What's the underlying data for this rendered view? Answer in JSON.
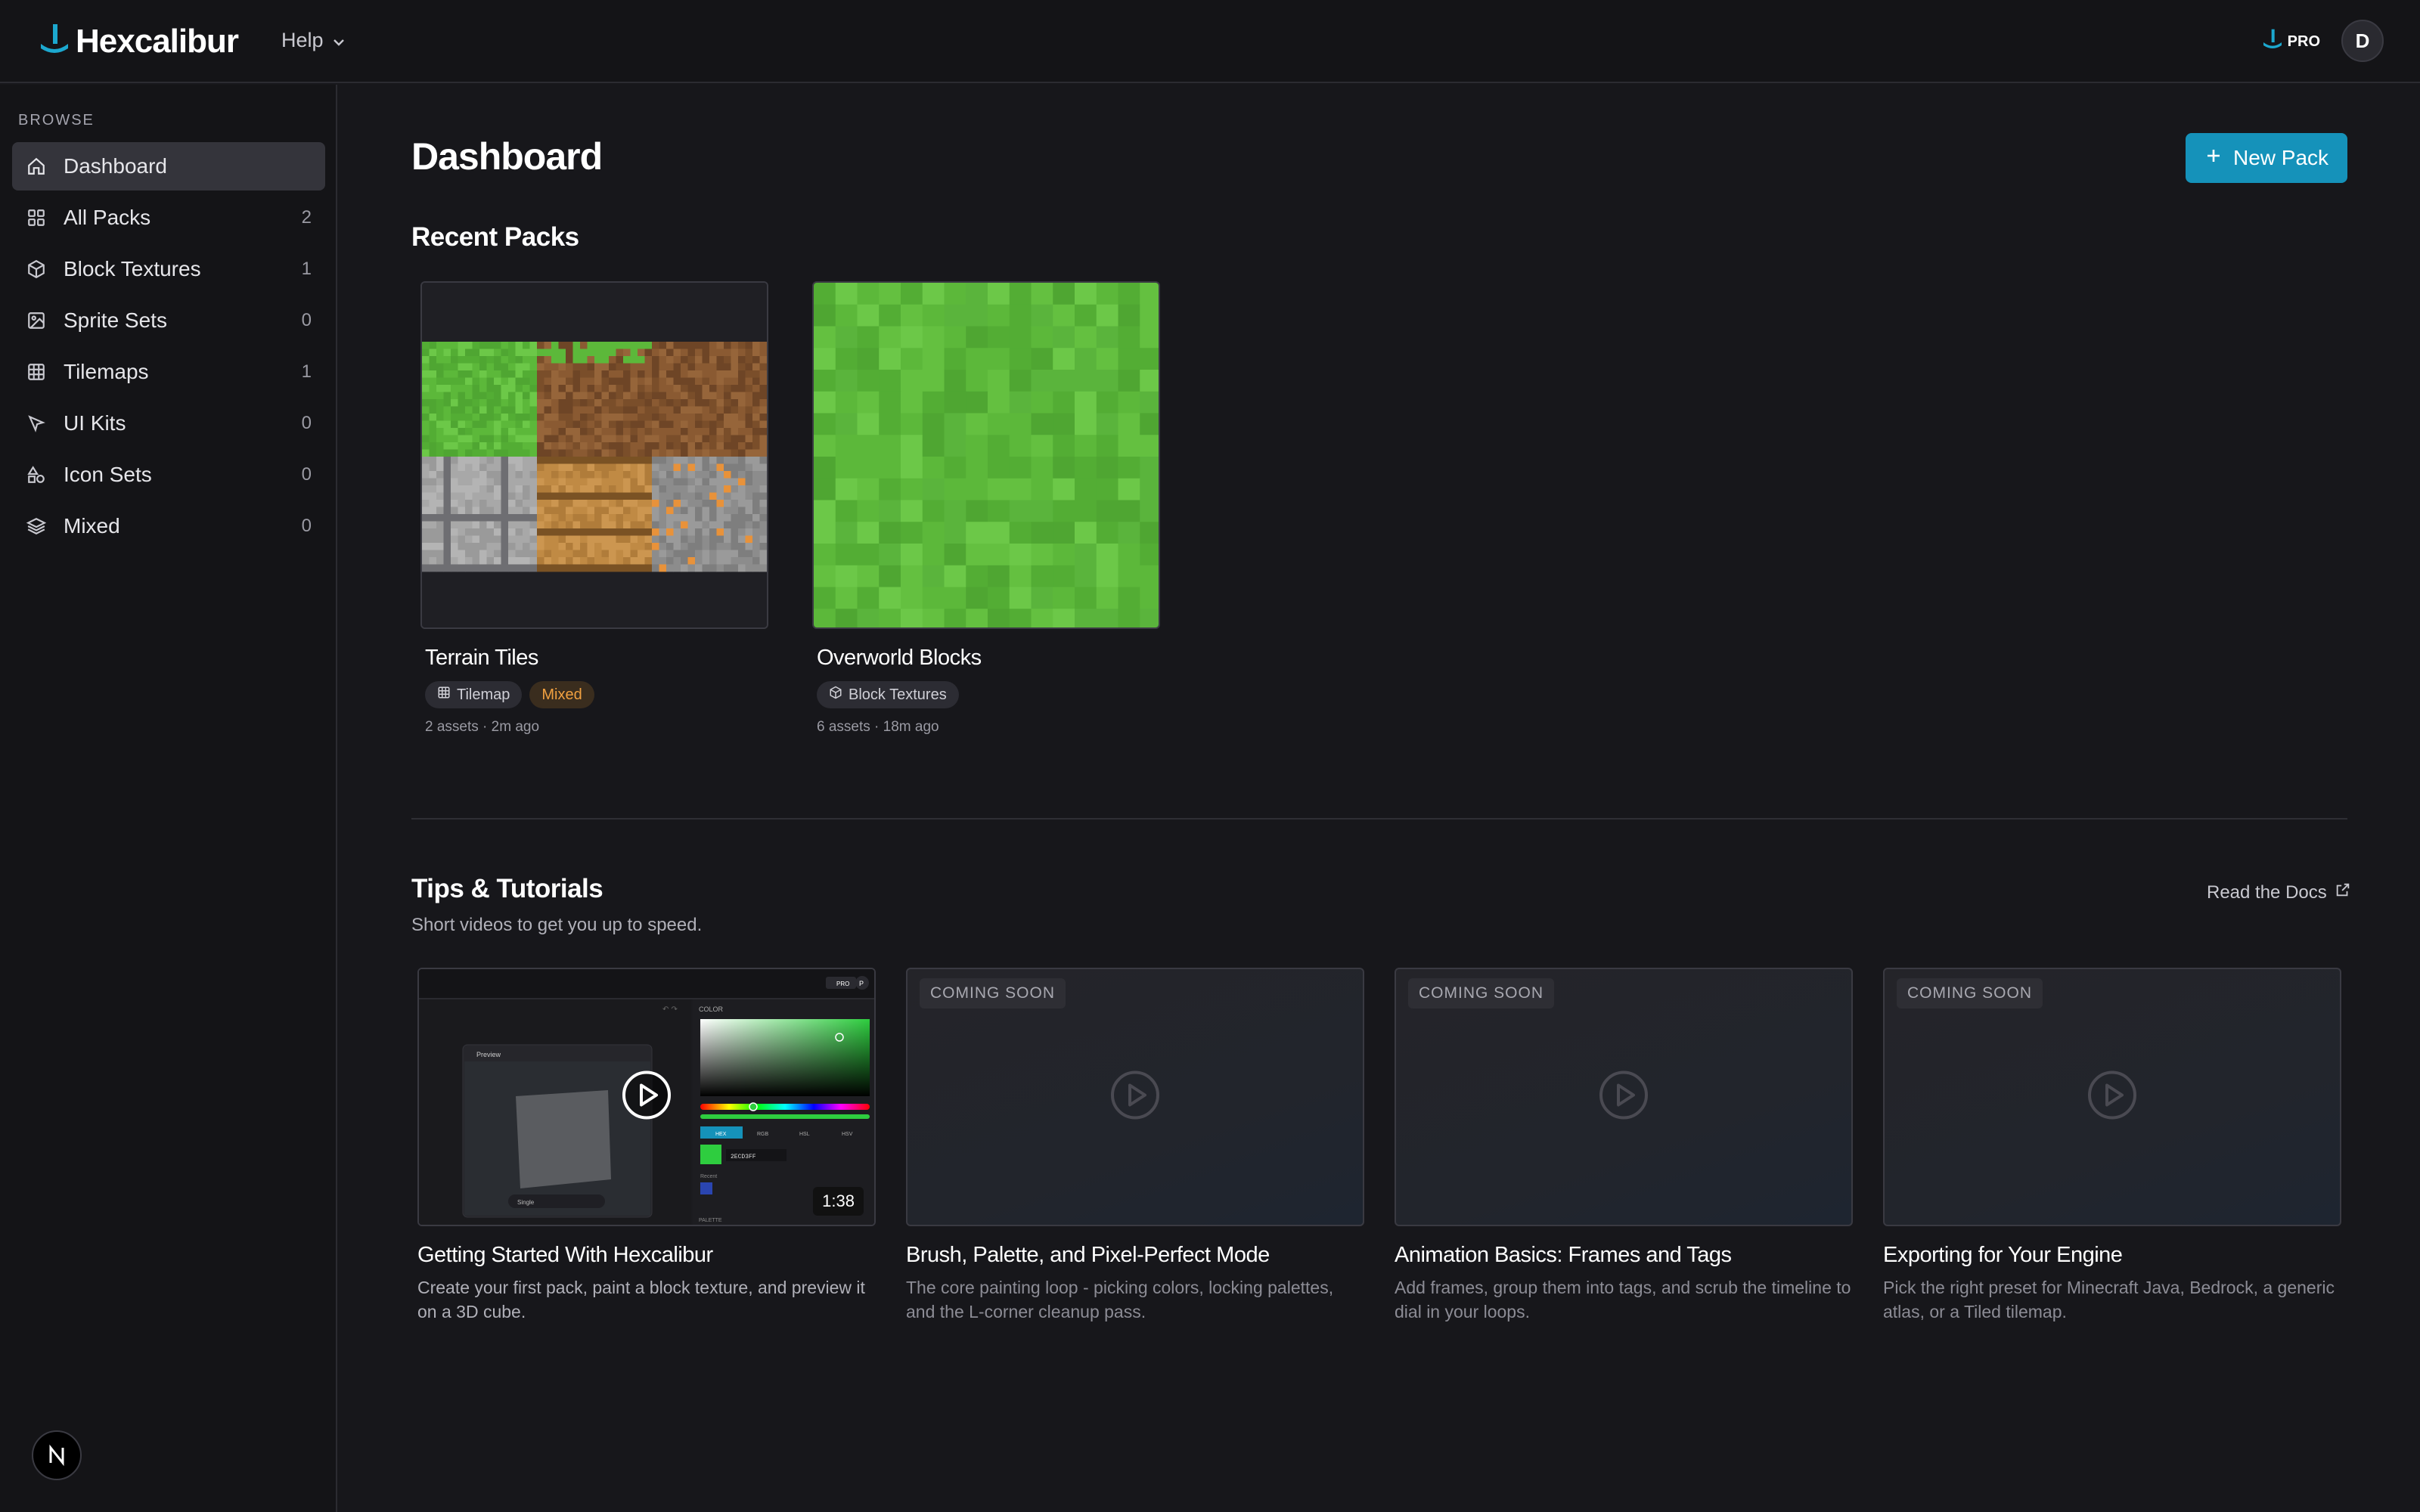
{
  "app": {
    "name": "Hexcalibur",
    "help_label": "Help",
    "plan_badge": "PRO",
    "avatar_initial": "D",
    "brand_color": "#1592ba"
  },
  "sidebar": {
    "heading": "BROWSE",
    "items": [
      {
        "label": "Dashboard",
        "count": "",
        "icon": "home-icon",
        "active": true
      },
      {
        "label": "All Packs",
        "count": "2",
        "icon": "grid-icon"
      },
      {
        "label": "Block Textures",
        "count": "1",
        "icon": "cube-icon"
      },
      {
        "label": "Sprite Sets",
        "count": "0",
        "icon": "image-icon"
      },
      {
        "label": "Tilemaps",
        "count": "1",
        "icon": "table-icon"
      },
      {
        "label": "UI Kits",
        "count": "0",
        "icon": "cursor-icon"
      },
      {
        "label": "Icon Sets",
        "count": "0",
        "icon": "shapes-icon"
      },
      {
        "label": "Mixed",
        "count": "0",
        "icon": "layers-icon"
      }
    ]
  },
  "main": {
    "title": "Dashboard",
    "new_pack_label": "New Pack",
    "recent": {
      "title": "Recent Packs",
      "packs": [
        {
          "name": "Terrain Tiles",
          "tags": [
            "Tilemap",
            "Mixed"
          ],
          "meta": "2 assets · 2m ago"
        },
        {
          "name": "Overworld Blocks",
          "tags": [
            "Block Textures"
          ],
          "meta": "6 assets · 18m ago"
        }
      ]
    },
    "tutorials": {
      "title": "Tips & Tutorials",
      "subtitle": "Short videos to get you up to speed.",
      "docs_label": "Read the Docs",
      "items": [
        {
          "title": "Getting Started With Hexcalibur",
          "desc": "Create your first pack, paint a block texture, and preview it on a 3D cube.",
          "duration": "1:38",
          "badge": ""
        },
        {
          "title": "Brush, Palette, and Pixel-Perfect Mode",
          "desc": "The core painting loop - picking colors, locking palettes, and the L-corner cleanup pass.",
          "badge": "COMING SOON"
        },
        {
          "title": "Animation Basics: Frames and Tags",
          "desc": "Add frames, group them into tags, and scrub the timeline to dial in your loops.",
          "badge": "COMING SOON"
        },
        {
          "title": "Exporting for Your Engine",
          "desc": "Pick the right preset for Minecraft Java, Bedrock, a generic atlas, or a Tiled tilemap.",
          "badge": "COMING SOON"
        }
      ]
    }
  },
  "preview": {
    "panel_title": "Preview",
    "color_label": "COLOR",
    "modes": [
      "HEX",
      "RGB",
      "HSL",
      "HSV"
    ],
    "hex_value": "2ECD3FF",
    "recent_label": "Recent",
    "palette_label": "PALETTE",
    "single_label": "Single",
    "brand_label": "PRO",
    "avatar": "P"
  }
}
